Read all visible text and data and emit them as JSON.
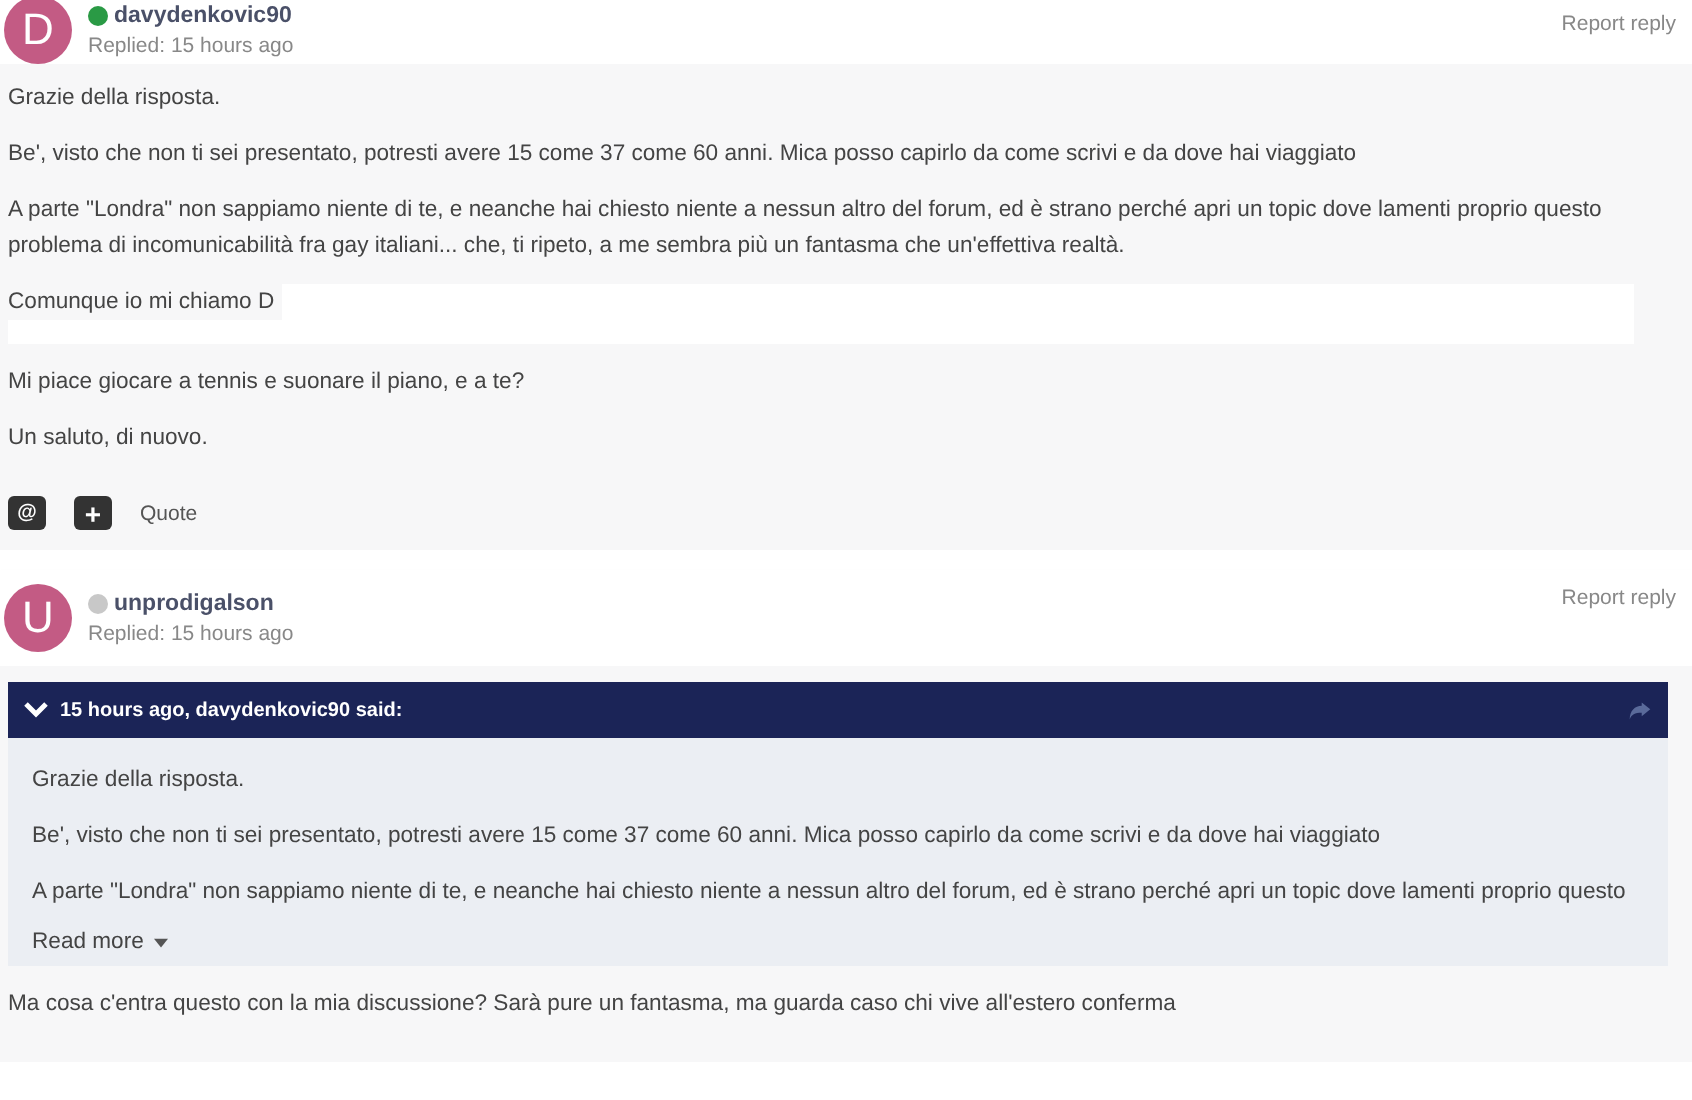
{
  "posts": [
    {
      "avatar": "D",
      "author": "davydenkovic90",
      "online": true,
      "replied": "Replied: 15 hours ago",
      "report": "Report reply",
      "paragraphs": [
        {
          "kind": "text",
          "text": "Grazie della risposta."
        },
        {
          "kind": "text",
          "text": "Be', visto che non ti sei presentato, potresti avere 15 come 37 come 60 anni. Mica posso capirlo da come scrivi e da dove hai viaggiato"
        },
        {
          "kind": "text",
          "text": "A parte \"Londra\" non sappiamo niente di te, e neanche hai chiesto niente a nessun altro del forum, ed è strano perché apri un topic dove lamenti proprio questo problema di incomunicabilità fra gay italiani... che, ti ripeto, a me sembra più un fantasma che un'effettiva realtà."
        },
        {
          "kind": "redacted",
          "text": "Comunque io mi chiamo D"
        },
        {
          "kind": "text",
          "text": "Mi piace giocare a tennis e suonare il piano, e a te?"
        },
        {
          "kind": "text",
          "text": "Un saluto, di nuovo."
        }
      ],
      "actions": [
        {
          "kind": "mention",
          "icon": "@"
        },
        {
          "kind": "add",
          "icon": "+"
        },
        {
          "kind": "link",
          "label": "Quote"
        }
      ]
    },
    {
      "avatar": "U",
      "author": "unprodigalson",
      "online": false,
      "replied": "Replied: 15 hours ago",
      "report": "Report reply",
      "quote": {
        "header": "15 hours ago, davydenkovic90 said:",
        "paragraphs": [
          "Grazie della risposta.",
          "Be', visto che non ti sei presentato, potresti avere 15 come 37 come 60 anni. Mica posso capirlo da come scrivi e da dove hai viaggiato",
          "A parte \"Londra\" non sappiamo niente di te, e neanche hai chiesto niente a nessun altro del forum, ed è strano perché apri un topic dove lamenti proprio questo"
        ],
        "more": "Read more"
      },
      "paragraphs": [
        {
          "kind": "text",
          "text": "Ma cosa c'entra questo con la mia discussione? Sarà pure un fantasma, ma guarda caso chi vive all'estero conferma"
        }
      ]
    }
  ]
}
